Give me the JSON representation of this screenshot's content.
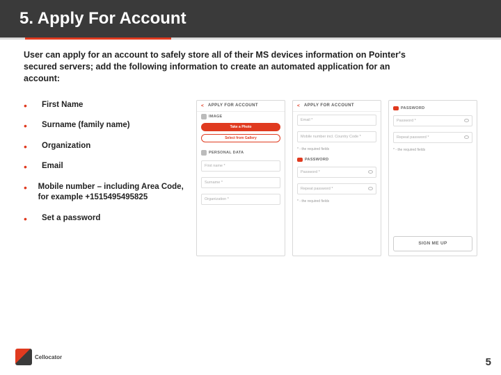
{
  "title": "5. Apply For Account",
  "intro": "User can apply for an account to safely store all of their MS devices information on Pointer's secured servers; add the following information to create an automated application for an account:",
  "bullets": [
    "First Name",
    "Surname (family name)",
    "Organization",
    "Email",
    "Mobile number – including Area Code, for example +1515495495825",
    "Set a password"
  ],
  "screens": {
    "s1": {
      "header": "APPLY FOR ACCOUNT",
      "image_label": "IMAGE",
      "btn_take": "Take a Photo",
      "btn_gallery": "Select from Gallery",
      "personal_label": "PERSONAL DATA",
      "fields": [
        "First name *",
        "Surname *",
        "Organization *"
      ]
    },
    "s2": {
      "header": "APPLY FOR ACCOUNT",
      "fields_top": [
        "Email *",
        "Mobile number incl. Country Code *"
      ],
      "req_top": "* - the required fields",
      "password_label": "PASSWORD",
      "fields_pw": [
        "Password *",
        "Repeat password *"
      ],
      "req_bottom": "* - the required fields"
    },
    "s3": {
      "password_label": "PASSWORD",
      "fields": [
        "Password *",
        "Repeat password *"
      ],
      "req": "* - the required fields",
      "signup": "SIGN ME UP"
    }
  },
  "logo_text": "Cellocator",
  "page_number": "5"
}
